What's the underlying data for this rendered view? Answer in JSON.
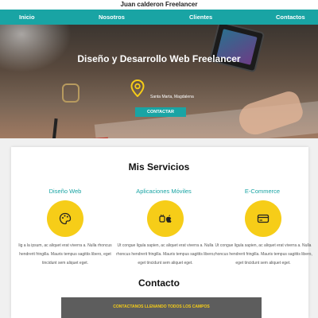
{
  "site_title": "Juan calderon Freelancer",
  "nav": {
    "items": [
      "Inicio",
      "Nosotros",
      "Clientes",
      "Contactos"
    ]
  },
  "hero": {
    "title": "Diseño y Desarrollo Web Freelancer",
    "location": "Santa Marta, Magdalena",
    "cta_label": "CONTACTAR"
  },
  "services": {
    "title": "Mis Servicios",
    "items": [
      {
        "name": "Diseño Web",
        "icon": "palette-icon",
        "description": "lig a la ipsum, ac aliquet erat viverra a. Nulla rhoncus hendrerit fringilla. Mauris tempus sagittis libero, eget tincidunt sem aliquet eget."
      },
      {
        "name": "Aplicaciones Móviles",
        "icon": "android-apple-icon",
        "description": "Ut congue ligula sapien, ac aliquet erat viverra a. Nulla rhoncus hendrerit fringilla. Mauris tempus sagittis libero, eget tincidunt sem aliquet eget."
      },
      {
        "name": "E-Commerce",
        "icon": "credit-card-icon",
        "description": "Ut congue ligula sapien, ac aliquet erat viverra a. Nulla rhoncus hendrerit fringilla. Mauris tempus sagittis libero, eget tincidunt sem aliquet eget."
      }
    ]
  },
  "contact": {
    "title": "Contacto",
    "banner": "CONTACTANOS LLENANDO TODOS LOS CAMPOS"
  },
  "colors": {
    "accent": "#19a4a4",
    "icon_circle": "#f6cd18",
    "banner_bg": "#5d5d5d"
  }
}
